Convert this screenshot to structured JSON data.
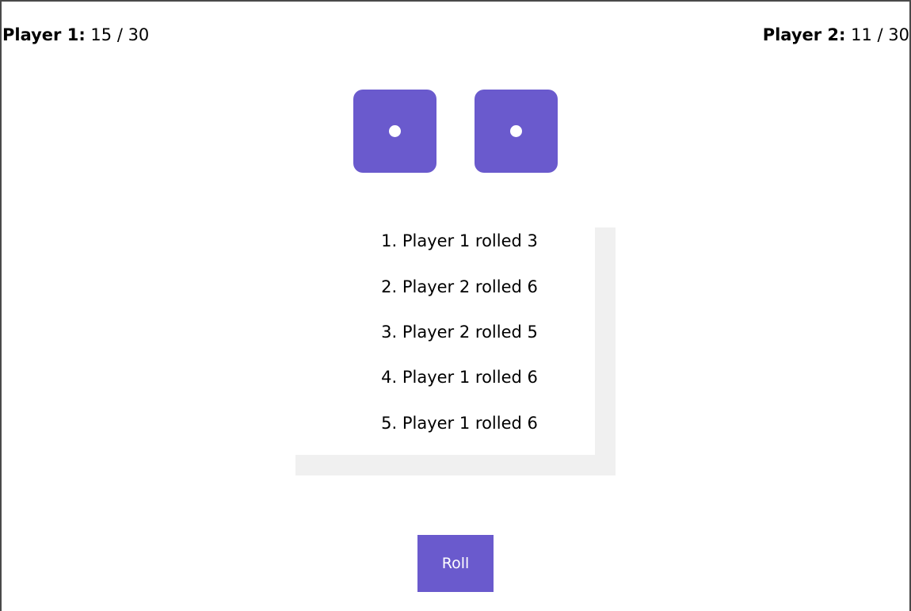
{
  "players": [
    {
      "label": "Player 1:",
      "score": "15 / 30"
    },
    {
      "label": "Player 2:",
      "score": "11 / 30"
    }
  ],
  "dice": [
    {
      "value": 1,
      "color": "#6a5acd"
    },
    {
      "value": 1,
      "color": "#6a5acd"
    }
  ],
  "log": [
    "1. Player 1 rolled 3",
    "2. Player 2 rolled 6",
    "3. Player 2 rolled 5",
    "4. Player 1 rolled 6",
    "5. Player 1 rolled 6"
  ],
  "roll_button": {
    "label": "Roll"
  },
  "colors": {
    "accent": "#6a5acd",
    "scrollbar": "#f0f0f0"
  }
}
